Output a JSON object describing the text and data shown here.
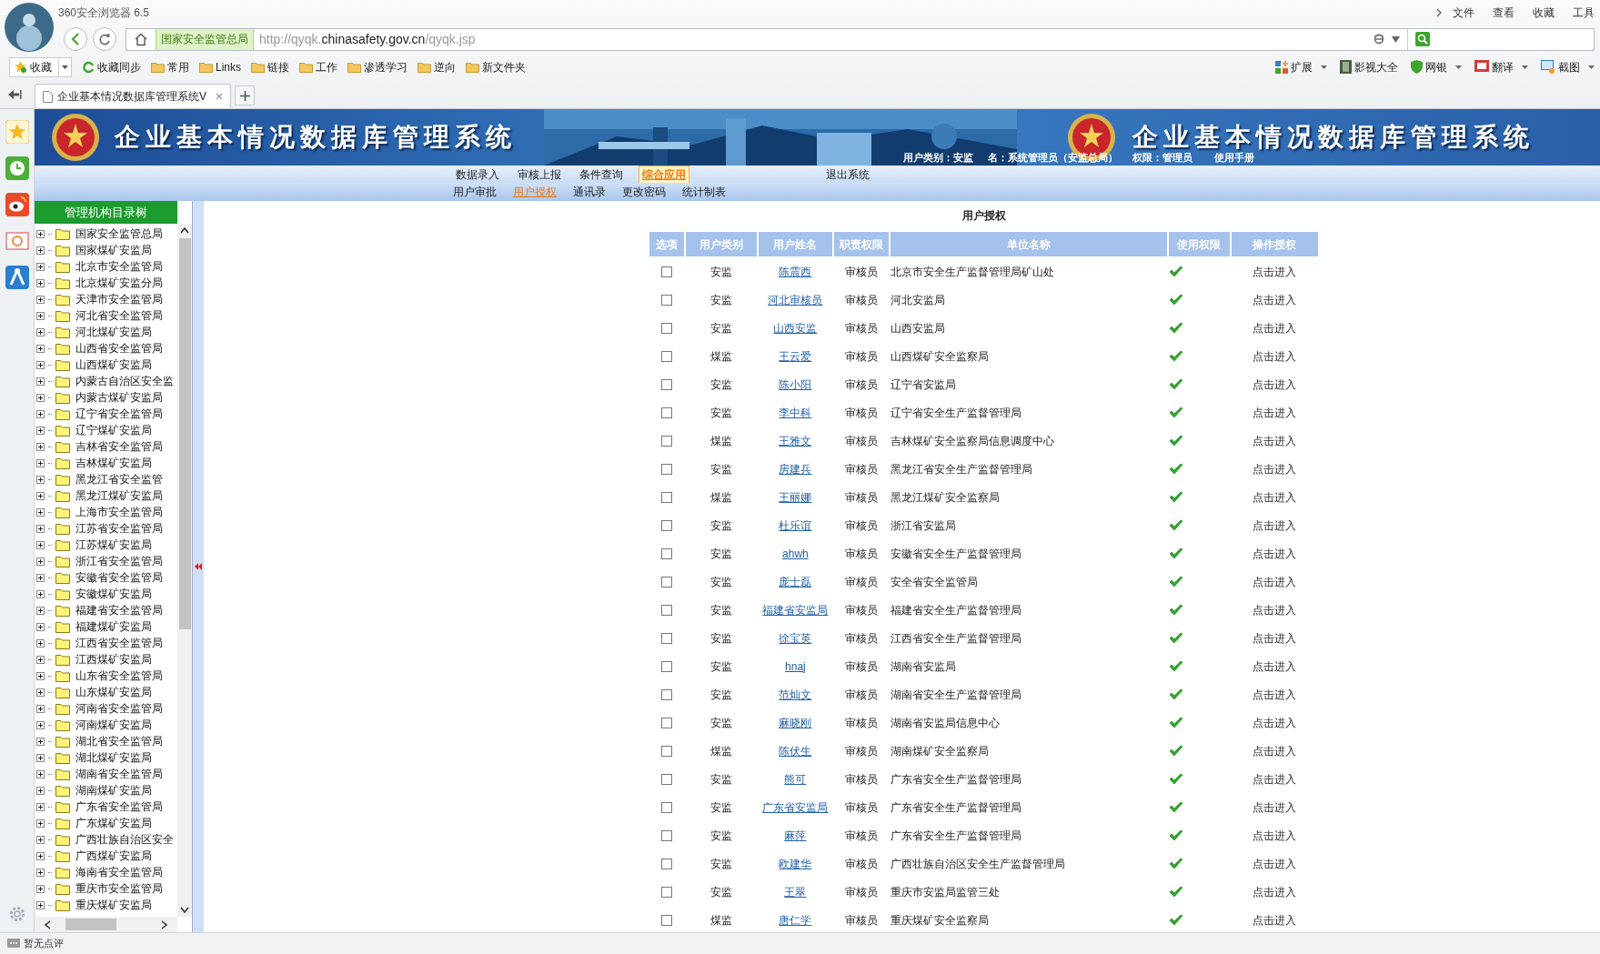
{
  "browser": {
    "title": "360安全浏览器 6.5",
    "menu": [
      "文件",
      "查看",
      "收藏",
      "工具"
    ],
    "site_label": "国家安全监管总局",
    "url": "http://qyqk.**chinasafety.gov.cn**/qyqk.jsp",
    "bookmarks": [
      {
        "label": "收藏",
        "kind": "fav"
      },
      {
        "label": "收藏同步",
        "kind": "sync"
      },
      {
        "label": "常用",
        "kind": "folder"
      },
      {
        "label": "Links",
        "kind": "folder"
      },
      {
        "label": "链接",
        "kind": "folder"
      },
      {
        "label": "工作",
        "kind": "folder"
      },
      {
        "label": "渗透学习",
        "kind": "folder"
      },
      {
        "label": "逆向",
        "kind": "folder"
      },
      {
        "label": "新文件夹",
        "kind": "folder"
      }
    ],
    "extensions": [
      {
        "label": "扩展",
        "kind": "apps",
        "dropdown": true
      },
      {
        "label": "影视大全",
        "kind": "film",
        "dropdown": false
      },
      {
        "label": "网银",
        "kind": "shield",
        "dropdown": true
      },
      {
        "label": "翻译",
        "kind": "translate",
        "dropdown": true
      },
      {
        "label": "截图",
        "kind": "screenshot",
        "dropdown": true
      }
    ],
    "tabs": [
      {
        "label": "企业基本情况数据库管理系统V",
        "selected": true
      }
    ]
  },
  "app": {
    "banner_title": "企业基本情况数据库管理系统",
    "banner_title_2": "企业基本情况数据库管理系统",
    "user_info": [
      "用户类别：安监",
      "名：系统管理员（安监总局）",
      "权限：管理员",
      "使用手册"
    ],
    "menu_primary": [
      {
        "label": "数据录入",
        "selected": false
      },
      {
        "label": "审核上报",
        "selected": false
      },
      {
        "label": "条件查询",
        "selected": false
      },
      {
        "label": "综合应用",
        "selected": true
      }
    ],
    "exit": "退出系统",
    "menu_secondary": [
      {
        "label": "用户审批",
        "selected": false
      },
      {
        "label": "用户授权",
        "selected": true
      },
      {
        "label": "通讯录",
        "selected": false
      },
      {
        "label": "更改密码",
        "selected": false
      },
      {
        "label": "统计制表",
        "selected": false
      }
    ]
  },
  "tree": {
    "title": "管理机构目录树",
    "items": [
      {
        "label": "国家安全监管总局",
        "expanded": false
      },
      {
        "label": "国家煤矿安监局",
        "expanded": false
      },
      {
        "label": "北京市安全监管局",
        "expanded": false
      },
      {
        "label": "北京煤矿安监分局",
        "expanded": false
      },
      {
        "label": "天津市安全监管局",
        "expanded": false
      },
      {
        "label": "河北省安全监管局",
        "expanded": false
      },
      {
        "label": "河北煤矿安监局",
        "expanded": false
      },
      {
        "label": "山西省安全监管局",
        "expanded": false
      },
      {
        "label": "山西煤矿安监局",
        "expanded": false
      },
      {
        "label": "内蒙古自治区安全监",
        "expanded": false
      },
      {
        "label": "内蒙古煤矿安监局",
        "expanded": false
      },
      {
        "label": "辽宁省安全监管局",
        "expanded": false
      },
      {
        "label": "辽宁煤矿安监局",
        "expanded": false
      },
      {
        "label": "吉林省安全监管局",
        "expanded": false
      },
      {
        "label": "吉林煤矿安监局",
        "expanded": false
      },
      {
        "label": "黑龙江省安全监管",
        "expanded": false
      },
      {
        "label": "黑龙江煤矿安监局",
        "expanded": false
      },
      {
        "label": "上海市安全监管局",
        "expanded": false
      },
      {
        "label": "江苏省安全监管局",
        "expanded": false
      },
      {
        "label": "江苏煤矿安监局",
        "expanded": false
      },
      {
        "label": "浙江省安全监管局",
        "expanded": false
      },
      {
        "label": "安徽省安全监管局",
        "expanded": false
      },
      {
        "label": "安徽煤矿安监局",
        "expanded": false
      },
      {
        "label": "福建省安全监管局",
        "expanded": false
      },
      {
        "label": "福建煤矿安监局",
        "expanded": false
      },
      {
        "label": "江西省安全监管局",
        "expanded": false
      },
      {
        "label": "江西煤矿安监局",
        "expanded": false
      },
      {
        "label": "山东省安全监管局",
        "expanded": false
      },
      {
        "label": "山东煤矿安监局",
        "expanded": false
      },
      {
        "label": "河南省安全监管局",
        "expanded": false
      },
      {
        "label": "河南煤矿安监局",
        "expanded": false
      },
      {
        "label": "湖北省安全监管局",
        "expanded": false
      },
      {
        "label": "湖北煤矿安监局",
        "expanded": false
      },
      {
        "label": "湖南省安全监管局",
        "expanded": false
      },
      {
        "label": "湖南煤矿安监局",
        "expanded": false
      },
      {
        "label": "广东省安全监管局",
        "expanded": false
      },
      {
        "label": "广东煤矿安监局",
        "expanded": false
      },
      {
        "label": "广西壮族自治区安全",
        "expanded": false
      },
      {
        "label": "广西煤矿安监局",
        "expanded": false
      },
      {
        "label": "海南省安全监管局",
        "expanded": false
      },
      {
        "label": "重庆市安全监管局",
        "expanded": false
      },
      {
        "label": "重庆煤矿安监局",
        "expanded": false
      }
    ]
  },
  "table": {
    "title": "用户授权",
    "columns": [
      "选项",
      "用户类别",
      "用户姓名",
      "职责权限",
      "单位名称",
      "使用权限",
      "操作授权"
    ],
    "rows": [
      {
        "checked": false,
        "category": "安监",
        "name": "陈震西",
        "role": "审核员",
        "unit": "北京市安全生产监督管理局矿山处",
        "permitted": true,
        "action": "点击进入"
      },
      {
        "checked": false,
        "category": "安监",
        "name": "河北审核员",
        "role": "审核员",
        "unit": "河北安监局",
        "permitted": true,
        "action": "点击进入"
      },
      {
        "checked": false,
        "category": "安监",
        "name": "山西安监",
        "role": "审核员",
        "unit": "山西安监局",
        "permitted": true,
        "action": "点击进入"
      },
      {
        "checked": false,
        "category": "煤监",
        "name": "王云爱",
        "role": "审核员",
        "unit": "山西煤矿安全监察局",
        "permitted": true,
        "action": "点击进入"
      },
      {
        "checked": false,
        "category": "安监",
        "name": "陈小阳",
        "role": "审核员",
        "unit": "辽宁省安监局",
        "permitted": true,
        "action": "点击进入"
      },
      {
        "checked": false,
        "category": "安监",
        "name": "李中科",
        "role": "审核员",
        "unit": "辽宁省安全生产监督管理局",
        "permitted": true,
        "action": "点击进入"
      },
      {
        "checked": false,
        "category": "煤监",
        "name": "王雅文",
        "role": "审核员",
        "unit": "吉林煤矿安全监察局信息调度中心",
        "permitted": true,
        "action": "点击进入"
      },
      {
        "checked": false,
        "category": "安监",
        "name": "房建兵",
        "role": "审核员",
        "unit": "黑龙江省安全生产监督管理局",
        "permitted": true,
        "action": "点击进入"
      },
      {
        "checked": false,
        "category": "煤监",
        "name": "王丽娜",
        "role": "审核员",
        "unit": "黑龙江煤矿安全监察局",
        "permitted": true,
        "action": "点击进入"
      },
      {
        "checked": false,
        "category": "安监",
        "name": "杜乐谊",
        "role": "审核员",
        "unit": "浙江省安监局",
        "permitted": true,
        "action": "点击进入"
      },
      {
        "checked": false,
        "category": "安监",
        "name": "ahwh",
        "role": "审核员",
        "unit": "安徽省安全生产监督管理局",
        "permitted": true,
        "action": "点击进入"
      },
      {
        "checked": false,
        "category": "安监",
        "name": "庞士磊",
        "role": "审核员",
        "unit": "安全省安全监管局",
        "permitted": true,
        "action": "点击进入"
      },
      {
        "checked": false,
        "category": "安监",
        "name": "福建省安监局",
        "role": "审核员",
        "unit": "福建省安全生产监督管理局",
        "permitted": true,
        "action": "点击进入"
      },
      {
        "checked": false,
        "category": "安监",
        "name": "徐宝英",
        "role": "审核员",
        "unit": "江西省安全生产监督管理局",
        "permitted": true,
        "action": "点击进入"
      },
      {
        "checked": false,
        "category": "安监",
        "name": "hnaj",
        "role": "审核员",
        "unit": "湖南省安监局",
        "permitted": true,
        "action": "点击进入"
      },
      {
        "checked": false,
        "category": "安监",
        "name": "范灿文",
        "role": "审核员",
        "unit": "湖南省安全生产监督管理局",
        "permitted": true,
        "action": "点击进入"
      },
      {
        "checked": false,
        "category": "安监",
        "name": "麻晓刚",
        "role": "审核员",
        "unit": "湖南省安监局信息中心",
        "permitted": true,
        "action": "点击进入"
      },
      {
        "checked": false,
        "category": "煤监",
        "name": "陈伏生",
        "role": "审核员",
        "unit": "湖南煤矿安全监察局",
        "permitted": true,
        "action": "点击进入"
      },
      {
        "checked": false,
        "category": "安监",
        "name": "熊可",
        "role": "审核员",
        "unit": "广东省安全生产监督管理局",
        "permitted": true,
        "action": "点击进入"
      },
      {
        "checked": false,
        "category": "安监",
        "name": "广东省安监局",
        "role": "审核员",
        "unit": "广东省安全生产监督管理局",
        "permitted": true,
        "action": "点击进入"
      },
      {
        "checked": false,
        "category": "安监",
        "name": "麻萍",
        "role": "审核员",
        "unit": "广东省安全生产监督管理局",
        "permitted": true,
        "action": "点击进入"
      },
      {
        "checked": false,
        "category": "安监",
        "name": "欧建华",
        "role": "审核员",
        "unit": "广西壮族自治区安全生产监督管理局",
        "permitted": true,
        "action": "点击进入"
      },
      {
        "checked": false,
        "category": "安监",
        "name": "王翠",
        "role": "审核员",
        "unit": "重庆市安监局监管三处",
        "permitted": true,
        "action": "点击进入"
      },
      {
        "checked": false,
        "category": "煤监",
        "name": "唐仁学",
        "role": "审核员",
        "unit": "重庆煤矿安全监察局",
        "permitted": true,
        "action": "点击进入"
      }
    ]
  },
  "status_bar": {
    "text": "暂无点评"
  }
}
